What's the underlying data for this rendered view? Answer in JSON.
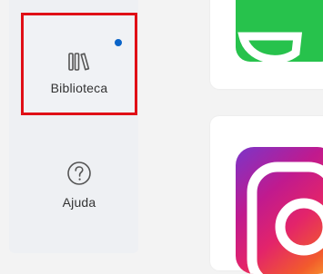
{
  "sidebar": {
    "items": [
      {
        "label": "Biblioteca",
        "icon": "library-icon",
        "selected": true,
        "has_badge": true,
        "badge_color": "#0a64c8"
      },
      {
        "label": "Ajuda",
        "icon": "help-icon",
        "selected": false
      }
    ]
  },
  "highlight_color": "#e00f16",
  "apps": [
    {
      "icon": "whatsapp-icon",
      "color": "#27c24c"
    },
    {
      "icon": "instagram-icon",
      "colors": [
        "#7b35c9",
        "#c01a8e",
        "#e3246a",
        "#f25b2c",
        "#f9a02c"
      ]
    }
  ]
}
